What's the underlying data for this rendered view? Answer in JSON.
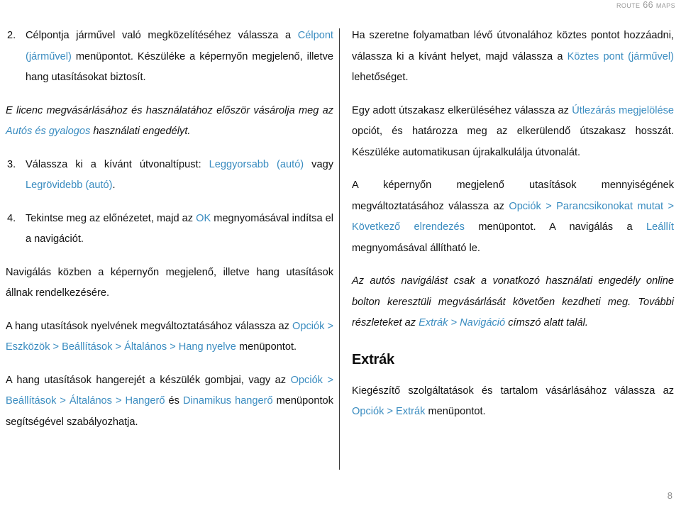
{
  "header": {
    "running_head": "Route 66 Maps"
  },
  "footer": {
    "page_number": "8"
  },
  "colors": {
    "link": "#3a8cc0",
    "body_text": "#111111",
    "header_text": "#9a9a9a",
    "divider": "#3a3a3a"
  },
  "left_column": {
    "blocks": [
      {
        "type": "numbered",
        "number": "2.",
        "segments": [
          {
            "text": "Célpontja járművel való megközelítéséhez válassza a ",
            "style": "normal"
          },
          {
            "text": "Célpont (járművel)",
            "style": "link"
          },
          {
            "text": " menüpontot. Készüléke a képernyőn megjelenő, illetve hang utasításokat biztosít.",
            "style": "normal"
          }
        ]
      },
      {
        "type": "paragraph",
        "italic": true,
        "segments": [
          {
            "text": "E licenc megvásárlásához és használatához először vásárolja meg az ",
            "style": "normal"
          },
          {
            "text": "Autós és gyalogos",
            "style": "link"
          },
          {
            "text": " használati engedélyt.",
            "style": "normal"
          }
        ]
      },
      {
        "type": "numbered",
        "number": "3.",
        "segments": [
          {
            "text": "Válassza ki a kívánt útvonaltípust: ",
            "style": "normal"
          },
          {
            "text": "Leggyorsabb (autó)",
            "style": "link"
          },
          {
            "text": " vagy ",
            "style": "normal"
          },
          {
            "text": "Legrövidebb (autó)",
            "style": "link"
          },
          {
            "text": ".",
            "style": "normal"
          }
        ]
      },
      {
        "type": "numbered",
        "number": "4.",
        "segments": [
          {
            "text": "Tekintse meg az előnézetet, majd az ",
            "style": "normal"
          },
          {
            "text": "OK",
            "style": "link"
          },
          {
            "text": " megnyomásával indítsa el a navigációt.",
            "style": "normal"
          }
        ]
      },
      {
        "type": "paragraph",
        "italic": false,
        "segments": [
          {
            "text": "Navigálás közben a képernyőn megjelenő, illetve hang utasítások állnak rendelkezésére.",
            "style": "normal"
          }
        ]
      },
      {
        "type": "paragraph",
        "italic": false,
        "segments": [
          {
            "text": "A hang utasítások nyelvének megváltoztatásához válassza az ",
            "style": "normal"
          },
          {
            "text": "Opciók > Eszközök > Beállítások > Általános > Hang nyelve",
            "style": "link"
          },
          {
            "text": " menüpontot.",
            "style": "normal"
          }
        ]
      },
      {
        "type": "paragraph",
        "italic": false,
        "segments": [
          {
            "text": "A hang utasítások hangerejét a készülék gombjai, vagy az ",
            "style": "normal"
          },
          {
            "text": "Opciók > Beállítások > Általános > Hangerő",
            "style": "link"
          },
          {
            "text": " és ",
            "style": "normal"
          },
          {
            "text": "Dinamikus hangerő",
            "style": "link"
          },
          {
            "text": " menüpontok segítségével szabályozhatja.",
            "style": "normal"
          }
        ]
      }
    ]
  },
  "right_column": {
    "blocks": [
      {
        "type": "paragraph",
        "italic": false,
        "segments": [
          {
            "text": "Ha szeretne folyamatban lévő útvonalához köztes pontot hozzáadni, válassza ki a kívánt helyet, majd válassza a ",
            "style": "normal"
          },
          {
            "text": "Köztes pont (járművel)",
            "style": "link"
          },
          {
            "text": " lehetőséget.",
            "style": "normal"
          }
        ]
      },
      {
        "type": "paragraph",
        "italic": false,
        "segments": [
          {
            "text": "Egy adott útszakasz elkerüléséhez válassza az ",
            "style": "normal"
          },
          {
            "text": "Útlezárás megjelölése",
            "style": "link"
          },
          {
            "text": " opciót, és határozza meg az elkerülendő útszakasz hosszát. Készüléke automatikusan újrakalkulálja útvonalát.",
            "style": "normal"
          }
        ]
      },
      {
        "type": "paragraph",
        "italic": false,
        "segments": [
          {
            "text": "A képernyőn megjelenő utasítások mennyiségének megváltoztatásához válassza az ",
            "style": "normal"
          },
          {
            "text": "Opciók > Parancsikonokat mutat > Következő elrendezés",
            "style": "link"
          },
          {
            "text": " menüpontot. A navigálás a ",
            "style": "normal"
          },
          {
            "text": "Leállít",
            "style": "link"
          },
          {
            "text": " megnyomásával állítható le.",
            "style": "normal"
          }
        ]
      },
      {
        "type": "paragraph",
        "italic": true,
        "segments": [
          {
            "text": "Az autós navigálást csak a vonatkozó használati engedély online bolton keresztüli megvásárlását követően kezdheti meg. További részleteket az ",
            "style": "normal"
          },
          {
            "text": "Extrák > Navigáció",
            "style": "link"
          },
          {
            "text": " címszó alatt talál.",
            "style": "normal"
          }
        ]
      },
      {
        "type": "heading",
        "text": "Extrák"
      },
      {
        "type": "paragraph",
        "italic": false,
        "segments": [
          {
            "text": "Kiegészítő szolgáltatások és tartalom vásárlásához válassza az ",
            "style": "normal"
          },
          {
            "text": "Opciók > Extrák",
            "style": "link"
          },
          {
            "text": " menüpontot.",
            "style": "normal"
          }
        ]
      }
    ]
  }
}
